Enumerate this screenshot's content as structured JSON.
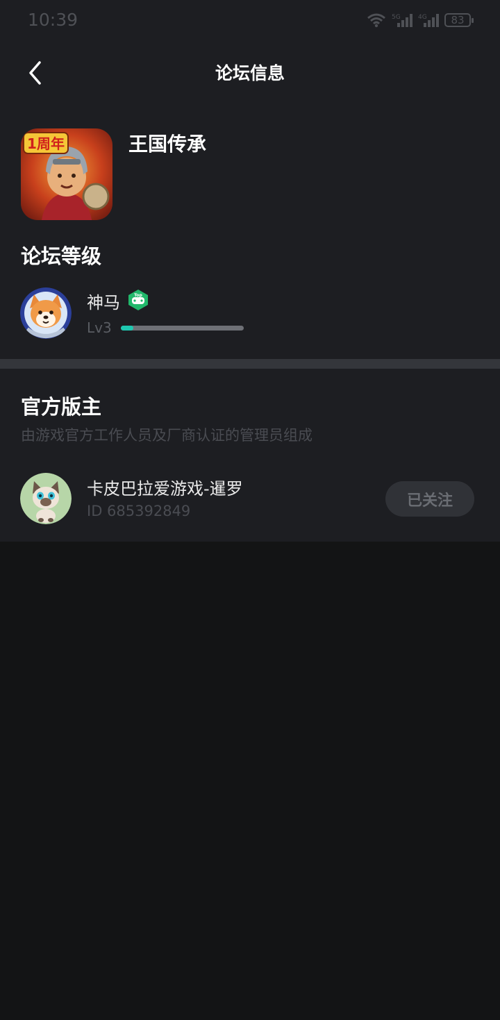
{
  "status_bar": {
    "time": "10:39",
    "network_5g": "5G",
    "network_4g": "4G",
    "battery": "83"
  },
  "header": {
    "title": "论坛信息",
    "back_icon": "chevron-left-icon"
  },
  "game": {
    "name": "王国传承",
    "icon_badge": "1周年"
  },
  "forum_level": {
    "section_title": "论坛等级",
    "user_name": "神马",
    "badge_text": "Top",
    "level": "Lv3",
    "progress": 0.1
  },
  "moderators": {
    "section_title": "官方版主",
    "subtitle": "由游戏官方工作人员及厂商认证的管理员组成",
    "items": [
      {
        "name": "卡皮巴拉爱游戏-暹罗",
        "id_text": "ID 685392849",
        "follow_label": "已关注"
      }
    ]
  },
  "colors": {
    "background": "#131415",
    "panel": "#1d1e22",
    "accent": "#1ec8b0",
    "badge_green": "#21b86b"
  }
}
